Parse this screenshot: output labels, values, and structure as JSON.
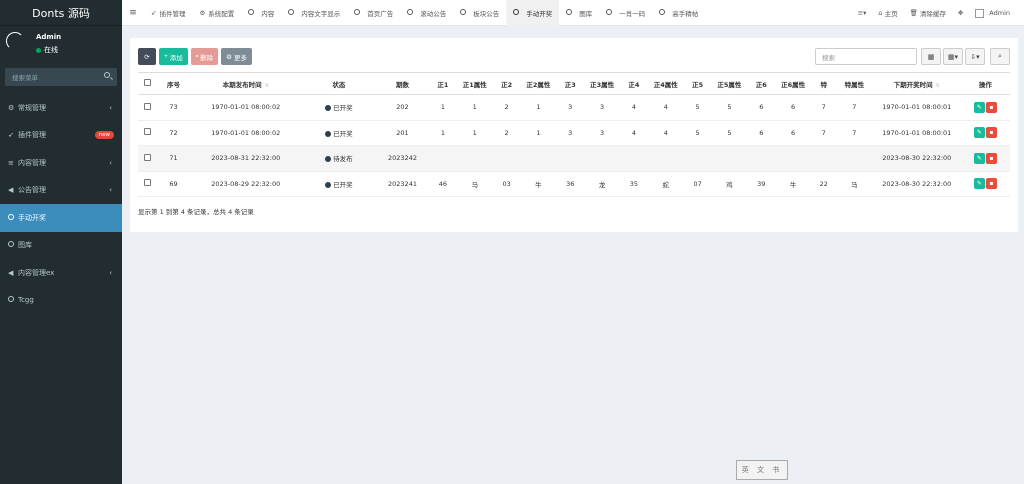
{
  "brand": "Donts 源码",
  "user": {
    "name": "Admin",
    "status": "在线"
  },
  "sidebar": {
    "search_placeholder": "搜索菜单",
    "items": [
      {
        "icon": "cogs-icon",
        "glyph": "⚙",
        "label": "常规管理",
        "has_chevron": true
      },
      {
        "icon": "rocket-icon",
        "glyph": "➶",
        "label": "插件管理",
        "badge": "new"
      },
      {
        "icon": "list-icon",
        "glyph": "≡",
        "label": "内容管理",
        "has_chevron": true
      },
      {
        "icon": "volume-icon",
        "glyph": "◀",
        "label": "公告管理",
        "has_chevron": true
      },
      {
        "icon": "circle-icon",
        "label": "手动开奖",
        "active": true
      },
      {
        "icon": "circle-icon",
        "label": "图库"
      },
      {
        "icon": "volume-icon",
        "glyph": "◀",
        "label": "内容管理ex",
        "has_chevron": true
      },
      {
        "icon": "circle-icon",
        "label": "Tcgg"
      }
    ]
  },
  "topnav": {
    "tabs": [
      {
        "icon": "rocket-icon",
        "label": "插件管理"
      },
      {
        "icon": "cogs-icon",
        "label": "系统配置"
      },
      {
        "icon": "circle-icon",
        "label": "内容"
      },
      {
        "icon": "circle-icon",
        "label": "内容文字显示"
      },
      {
        "icon": "circle-icon",
        "label": "首页广告"
      },
      {
        "icon": "circle-icon",
        "label": "滚动公告"
      },
      {
        "icon": "circle-icon",
        "label": "板块公告"
      },
      {
        "icon": "circle-icon",
        "label": "手动开奖",
        "active": true
      },
      {
        "icon": "circle-icon",
        "label": "图库"
      },
      {
        "icon": "circle-icon",
        "label": "一肖一码"
      },
      {
        "icon": "circle-icon",
        "label": "高手精帖"
      }
    ],
    "home": "主页",
    "clear_cache": "清除缓存",
    "admin": "Admin"
  },
  "toolbar": {
    "add": "添加",
    "delete": "删除",
    "more": "更多",
    "search_placeholder": "搜索"
  },
  "table": {
    "headers": [
      "序号",
      "本期发布时间",
      "状态",
      "期数",
      "正1",
      "正1属性",
      "正2",
      "正2属性",
      "正3",
      "正3属性",
      "正4",
      "正4属性",
      "正5",
      "正5属性",
      "正6",
      "正6属性",
      "特",
      "特属性",
      "下期开奖时间",
      "操作"
    ],
    "rows": [
      [
        "73",
        "1970-01-01 08:00:02",
        "已开奖",
        "202",
        "1",
        "1",
        "2",
        "1",
        "3",
        "3",
        "4",
        "4",
        "5",
        "5",
        "6",
        "6",
        "7",
        "7",
        "1970-01-01 08:00:01"
      ],
      [
        "72",
        "1970-01-01 08:00:02",
        "已开奖",
        "201",
        "1",
        "1",
        "2",
        "1",
        "3",
        "3",
        "4",
        "4",
        "5",
        "5",
        "6",
        "6",
        "7",
        "7",
        "1970-01-01 08:00:01"
      ],
      [
        "71",
        "2023-08-31 22:32:00",
        "待发布",
        "2023242",
        "",
        "",
        "",
        "",
        "",
        "",
        "",
        "",
        "",
        "",
        "",
        "",
        "",
        "",
        "2023-08-30 22:32:00"
      ],
      [
        "69",
        "2023-08-29 22:32:00",
        "已开奖",
        "2023241",
        "46",
        "马",
        "03",
        "牛",
        "36",
        "龙",
        "35",
        "蛇",
        "07",
        "鸡",
        "39",
        "牛",
        "22",
        "马",
        "2023-08-30 22:32:00"
      ]
    ],
    "footer": "显示第 1 到第 4 条记录，总共 4 条记录"
  },
  "watermark": "英 文 书"
}
